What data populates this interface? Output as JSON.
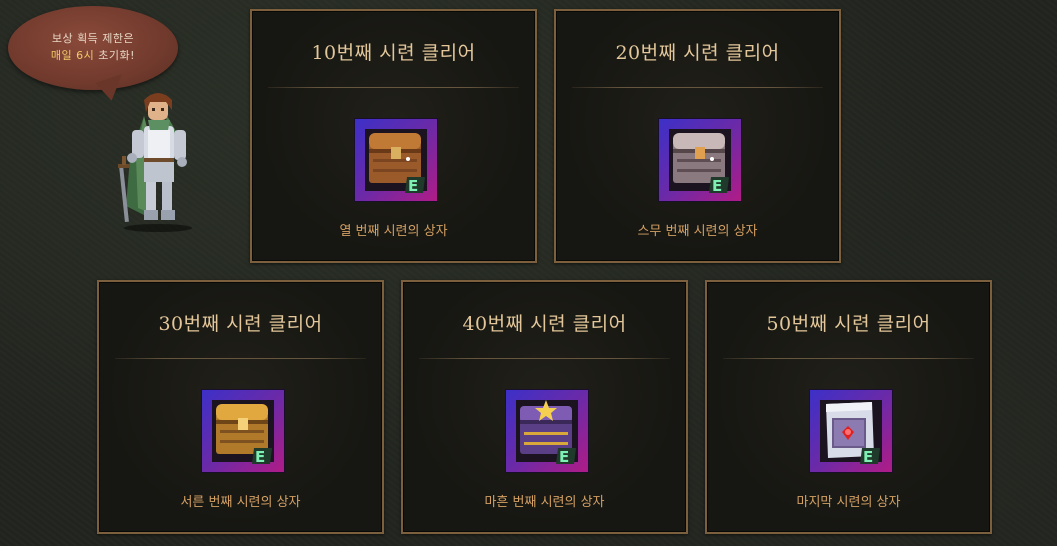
{
  "notice": {
    "line1": "보상 획득 제한은",
    "line2_highlight": "매일 6시",
    "line2_rest": " 초기화!"
  },
  "colors": {
    "accent_gold": "#e3c79a",
    "item_name": "#d4a063",
    "card_border": "#7c5f3c",
    "bubble": "#713a2d"
  },
  "cards": [
    {
      "title": "10번째 시련 클리어",
      "item_name": "열 번째 시련의 상자",
      "icon": "treasure-chest-icon"
    },
    {
      "title": "20번째 시련 클리어",
      "item_name": "스무 번째 시련의 상자",
      "icon": "silver-chest-icon"
    },
    {
      "title": "30번째 시련 클리어",
      "item_name": "서른 번째 시련의 상자",
      "icon": "gold-chest-icon"
    },
    {
      "title": "40번째 시련 클리어",
      "item_name": "마흔 번째 시련의 상자",
      "icon": "purple-chest-icon"
    },
    {
      "title": "50번째 시련 클리어",
      "item_name": "마지막 시련의 상자",
      "icon": "scroll-chest-icon"
    }
  ]
}
